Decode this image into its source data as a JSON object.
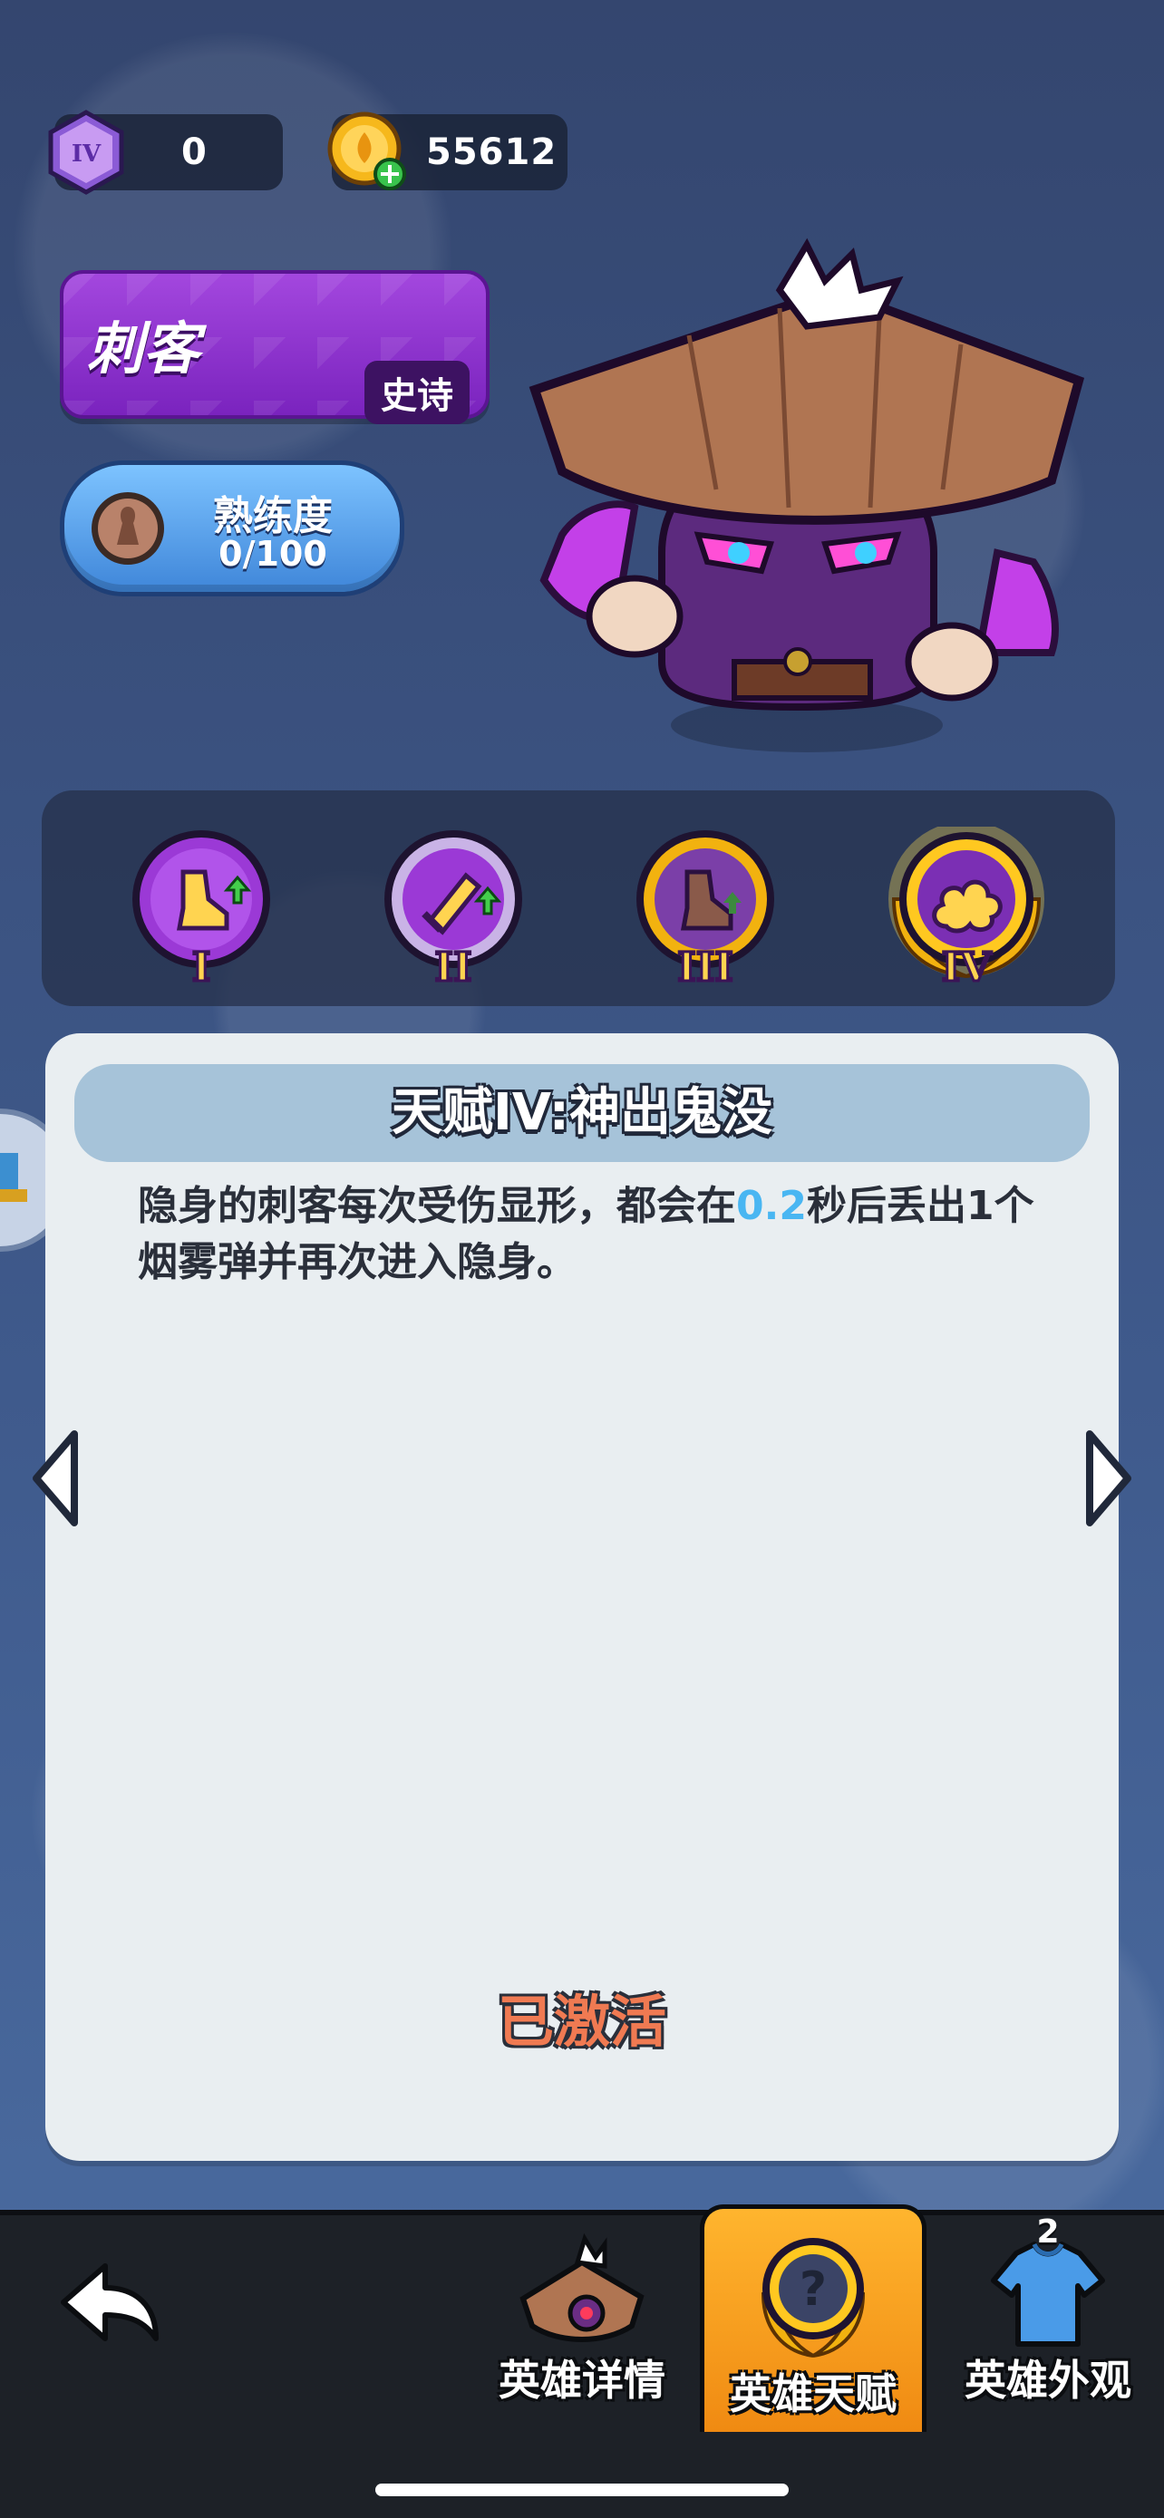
{
  "currency": {
    "gems": {
      "value": "0",
      "icon": "gem-iv-icon",
      "icon_text": "IV"
    },
    "coins": {
      "value": "55612",
      "icon": "gold-coin-add-icon"
    }
  },
  "hero": {
    "name": "刺客",
    "rarity": "史诗",
    "proficiency_label": "熟练度",
    "proficiency_value": "0/100",
    "art": "assassin-hero-art"
  },
  "talents": [
    {
      "numeral": "I",
      "icon": "boot-upgrade-icon",
      "state": "unlocked"
    },
    {
      "numeral": "II",
      "icon": "sword-upgrade-icon",
      "state": "unlocked"
    },
    {
      "numeral": "III",
      "icon": "boot-upgrade-icon",
      "state": "gold"
    },
    {
      "numeral": "IV",
      "icon": "smoke-cloud-icon",
      "state": "selected"
    }
  ],
  "detail": {
    "title": "天赋IV:神出鬼没",
    "desc_before": "隐身的刺客每次受伤显形，都会在",
    "desc_highlight": "0.2",
    "desc_after": "秒后丢出1个烟雾弹并再次进入隐身。",
    "status": "已激活"
  },
  "nav": {
    "back_icon": "back-arrow-icon",
    "tabs": [
      {
        "label": "英雄详情",
        "icon": "hero-portrait-icon"
      },
      {
        "label": "英雄天赋",
        "icon": "talent-question-icon",
        "active": true
      },
      {
        "label": "英雄外观",
        "icon": "shirt-icon",
        "badge": "2"
      }
    ]
  },
  "colors": {
    "accent_orange": "#f08a12",
    "rarity_purple": "#8f32cf",
    "highlight_blue": "#49b6f2",
    "status_orange": "#f07a52"
  }
}
